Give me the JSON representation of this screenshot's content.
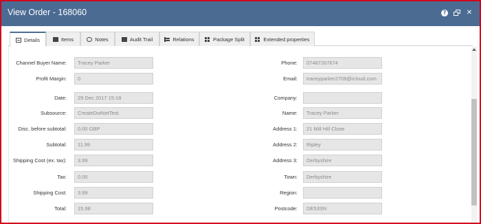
{
  "window": {
    "title": "View Order - 168060"
  },
  "tabs": [
    {
      "label": "Details",
      "icon": "details-icon"
    },
    {
      "label": "Items",
      "icon": "items-icon"
    },
    {
      "label": "Notes",
      "icon": "notes-icon"
    },
    {
      "label": "Audit Trail",
      "icon": "audit-trail-icon"
    },
    {
      "label": "Relations",
      "icon": "relations-icon"
    },
    {
      "label": "Package Split",
      "icon": "package-split-icon"
    },
    {
      "label": "Extended properties",
      "icon": "extended-properties-icon"
    }
  ],
  "left_fields": [
    {
      "label": "Channel Buyer Name:",
      "value": "Tracey Parker"
    },
    {
      "label": "Profit Margin:",
      "value": "0"
    },
    {
      "label": "Date:",
      "value": "29 Dec 2017 15:18"
    },
    {
      "label": "Subsource:",
      "value": "CreateDotNetTest"
    },
    {
      "label": "Disc. before subtotal:",
      "value": "0.00 GBP"
    },
    {
      "label": "Subtotal:",
      "value": "11.99"
    },
    {
      "label": "Shipping Cost (ex. tax):",
      "value": "3.99"
    },
    {
      "label": "Tax:",
      "value": "0.00"
    },
    {
      "label": "Shipping Cost:",
      "value": "3.99"
    },
    {
      "label": "Total:",
      "value": "15.98"
    }
  ],
  "right_fields": [
    {
      "label": "Phone:",
      "value": "07487267674"
    },
    {
      "label": "Email:",
      "value": "traceyparker2708@icloud.com"
    },
    {
      "label": "Company:",
      "value": ""
    },
    {
      "label": "Name:",
      "value": "Tracey Parker"
    },
    {
      "label": "Address 1:",
      "value": "21 Mill Hill Close"
    },
    {
      "label": "Address 2:",
      "value": "Ripley"
    },
    {
      "label": "Address 3:",
      "value": "Derbyshire"
    },
    {
      "label": "Town:",
      "value": "Derbyshire"
    },
    {
      "label": "Region:",
      "value": ""
    },
    {
      "label": "Postcode:",
      "value": "DE53SN"
    }
  ],
  "colors": {
    "titlebar": "#4b6b93",
    "border": "#d0021b",
    "field_bg": "#e6e6e6"
  }
}
